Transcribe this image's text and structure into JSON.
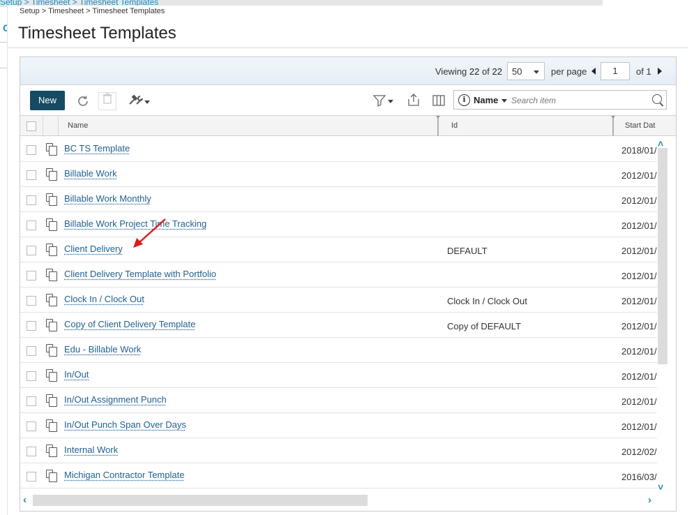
{
  "background": {
    "breadcrumb": "Setup > Timesheet > Timesheet Templates",
    "initial": "C"
  },
  "breadcrumb": "Setup > Timesheet > Timesheet Templates",
  "page_title": "Timesheet Templates",
  "pager": {
    "viewing_label": "Viewing",
    "viewing_count": "22",
    "of_label": "of",
    "total": "22",
    "per_page_value": "50",
    "per_page_label": "per page",
    "current_page": "1",
    "page_of_label": "of 1"
  },
  "toolbar": {
    "new_label": "New",
    "search_field": "Name",
    "search_placeholder": "Search item"
  },
  "columns": {
    "name": "Name",
    "id": "Id",
    "start_date": "Start Dat"
  },
  "rows": [
    {
      "name": "BC TS Template",
      "id": "",
      "date": "2018/01/"
    },
    {
      "name": "Billable Work",
      "id": "",
      "date": "2012/01/"
    },
    {
      "name": "Billable Work Monthly",
      "id": "",
      "date": "2012/01/"
    },
    {
      "name": "Billable Work Project Time Tracking",
      "id": "",
      "date": "2012/01/"
    },
    {
      "name": "Client Delivery",
      "id": "DEFAULT",
      "date": "2012/01/"
    },
    {
      "name": "Client Delivery Template with Portfolio",
      "id": "",
      "date": "2012/01/"
    },
    {
      "name": "Clock In / Clock Out",
      "id": "Clock In / Clock Out",
      "date": "2012/01/"
    },
    {
      "name": "Copy of Client Delivery Template",
      "id": "Copy of DEFAULT",
      "date": "2012/01/"
    },
    {
      "name": "Edu - Billable Work",
      "id": "",
      "date": "2012/01/"
    },
    {
      "name": "In/Out",
      "id": "",
      "date": "2012/01/"
    },
    {
      "name": "In/Out Assignment Punch",
      "id": "",
      "date": "2012/01/"
    },
    {
      "name": "In/Out Punch Span Over Days",
      "id": "",
      "date": "2012/01/"
    },
    {
      "name": "Internal Work",
      "id": "",
      "date": "2012/02/"
    },
    {
      "name": "Michigan Contractor Template",
      "id": "",
      "date": "2016/03/"
    }
  ],
  "icons": {
    "row_icon": "copy-icon",
    "refresh": "refresh-icon",
    "delete": "trash-icon",
    "tools": "tools-icon",
    "filter": "filter-icon",
    "export": "export-icon",
    "columns": "columns-icon",
    "info": "info-icon",
    "search": "search-icon"
  },
  "colors": {
    "new_button": "#174b63",
    "link": "#1f5f93",
    "annotation_arrow": "#e01b1b",
    "scroll_arrow": "#1a8bc8"
  }
}
